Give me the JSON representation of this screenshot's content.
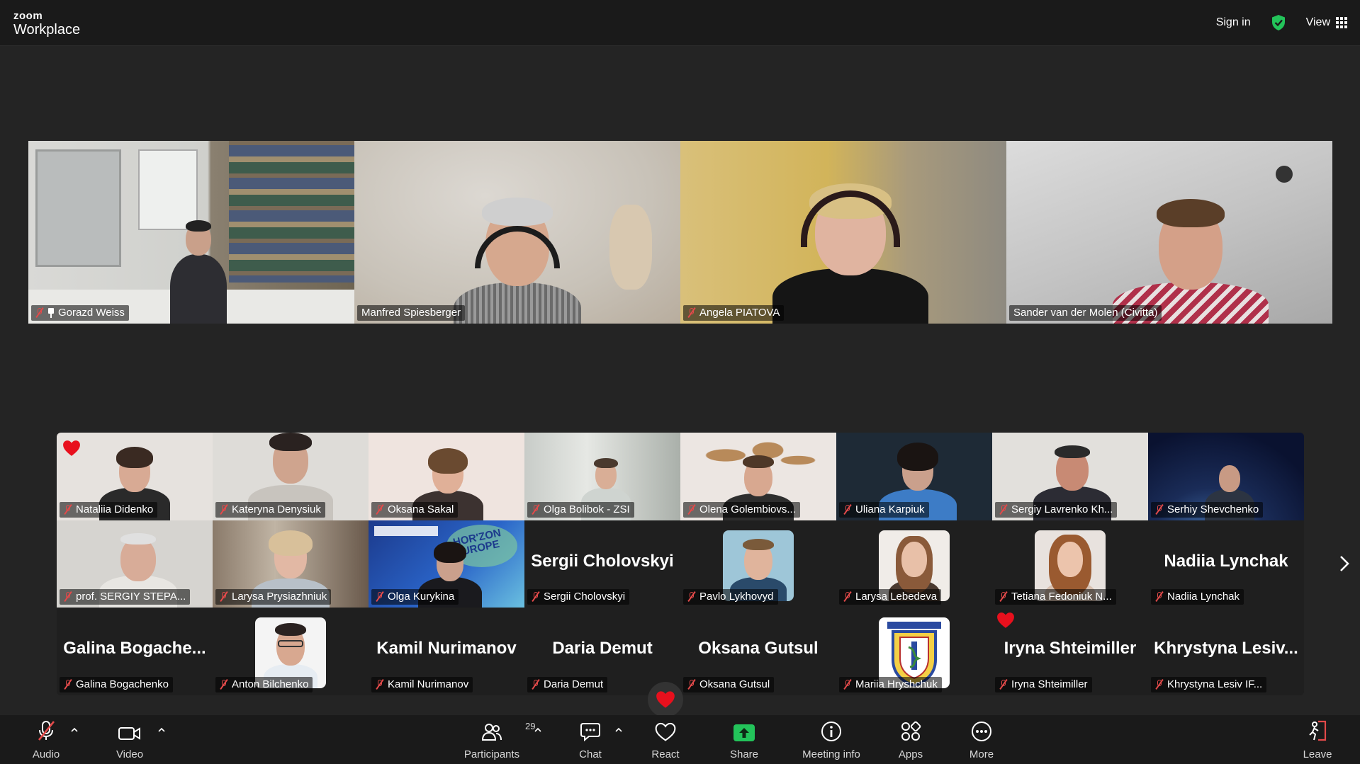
{
  "app": {
    "logo_small": "zoom",
    "logo_large": "Workplace"
  },
  "topbar": {
    "signin_label": "Sign in",
    "view_label": "View"
  },
  "top_tiles": [
    {
      "name": "Gorazd Weiss",
      "muted": true,
      "pinned": true
    },
    {
      "name": "Manfred Spiesberger",
      "muted": false
    },
    {
      "name": "Angela PIATOVA",
      "muted": true
    },
    {
      "name": "Sander van der Molen (Civitta)",
      "muted": false,
      "active_speaker": true
    }
  ],
  "gallery": [
    {
      "name": "Nataliia Didenko",
      "reaction": "heart"
    },
    {
      "name": "Kateryna Denysiuk"
    },
    {
      "name": "Oksana Sakal"
    },
    {
      "name": "Olga Bolibok - ZSI"
    },
    {
      "name": "Olena Golembiovs..."
    },
    {
      "name": "Uliana Karpiuk"
    },
    {
      "name": "Sergiy Lavrenko Kh..."
    },
    {
      "name": "Serhiy Shevchenko"
    },
    {
      "name": "prof. SERGIY STEPA..."
    },
    {
      "name": "Larysa Prysiazhniuk"
    },
    {
      "name": "Olga Kurykina",
      "banner": "HOR'ZON EUROPE"
    },
    {
      "name": "Sergii Cholovskyi",
      "display_name": "Sergii Cholovskyi"
    },
    {
      "name": "Pavlo Lykhovyd"
    },
    {
      "name": "Larysa Lebedeva"
    },
    {
      "name": "Tetiana Fedoniuk N..."
    },
    {
      "name": "Nadiia Lynchak",
      "display_name": "Nadiia Lynchak"
    },
    {
      "name": "Galina Bogachenko",
      "display_name": "Galina  Bogache..."
    },
    {
      "name": "Anton Bilchenko"
    },
    {
      "name": "Kamil Nurimanov",
      "display_name": "Kamil Nurimanov"
    },
    {
      "name": "Daria Demut",
      "display_name": "Daria Demut"
    },
    {
      "name": "Oksana Gutsul",
      "display_name": "Oksana Gutsul"
    },
    {
      "name": "Mariia Hryshchuk"
    },
    {
      "name": "Iryna Shteimiller",
      "display_name": "Iryna Shteimiller",
      "reaction": "heart"
    },
    {
      "name": "Khrystyna Lesiv IF...",
      "display_name": "Khrystyna  Lesiv..."
    }
  ],
  "toolbar": {
    "audio": "Audio",
    "video": "Video",
    "participants": "Participants",
    "participants_count": "29",
    "chat": "Chat",
    "react": "React",
    "share": "Share",
    "meeting_info": "Meeting info",
    "apps": "Apps",
    "more": "More",
    "leave": "Leave"
  },
  "colors": {
    "active_speaker": "#2fd39a",
    "mute": "#e24a4a",
    "share": "#23c35a",
    "heart": "#e8101d"
  }
}
